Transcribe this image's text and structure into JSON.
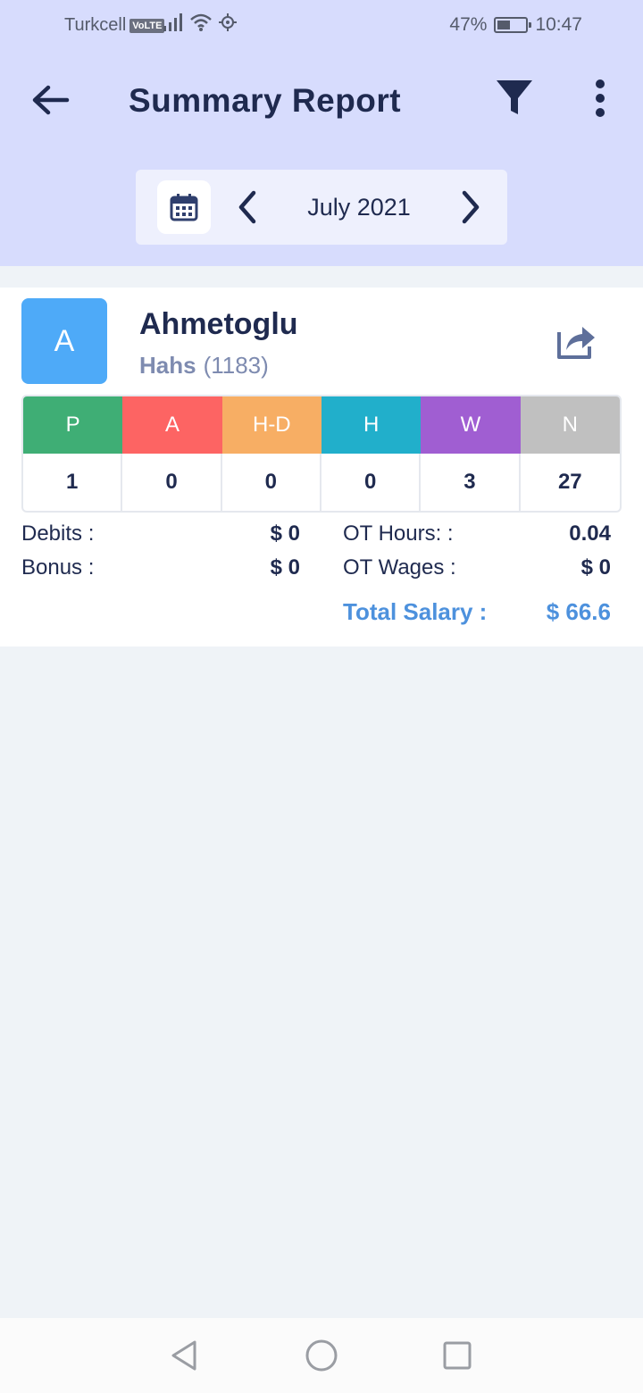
{
  "status_bar": {
    "carrier": "Turkcell",
    "volte": "VoLTE",
    "battery": "47%",
    "battery_level": 0.47,
    "time": "10:47",
    "icons": [
      "signal-icon",
      "wifi-icon",
      "location-icon",
      "battery-icon"
    ]
  },
  "app_bar": {
    "title": "Summary Report",
    "icons": [
      "back-arrow-icon",
      "filter-icon",
      "more-vert-icon"
    ]
  },
  "month_selector": {
    "label": "July 2021",
    "icons": [
      "calendar-icon",
      "chevron-left-icon",
      "chevron-right-icon"
    ]
  },
  "employee": {
    "avatar_letter": "A",
    "name": "Ahmetoglu",
    "department": "Hahs",
    "code": "(1183)"
  },
  "attendance": {
    "columns": [
      {
        "label": "P",
        "value": "1",
        "color": "#3fae75"
      },
      {
        "label": "A",
        "value": "0",
        "color": "#fd6463"
      },
      {
        "label": "H-D",
        "value": "0",
        "color": "#f7ae64"
      },
      {
        "label": "H",
        "value": "0",
        "color": "#21afcb"
      },
      {
        "label": "W",
        "value": "3",
        "color": "#a05ed2"
      },
      {
        "label": "N",
        "value": "27",
        "color": "#c0c0c0"
      }
    ]
  },
  "finance": {
    "debits_label": "Debits :",
    "debits_value": "$ 0",
    "bonus_label": "Bonus :",
    "bonus_value": "$ 0",
    "ot_hours_label": "OT Hours: :",
    "ot_hours_value": "0.04",
    "ot_wages_label": "OT Wages :",
    "ot_wages_value": "$ 0",
    "total_label": "Total Salary :",
    "total_value": "$ 66.6"
  },
  "colors": {
    "header_bg": "#d7dcfd",
    "accent_blue": "#4d91dd",
    "avatar_bg": "#4eaaf8",
    "text_dark": "#1f2a4f"
  }
}
